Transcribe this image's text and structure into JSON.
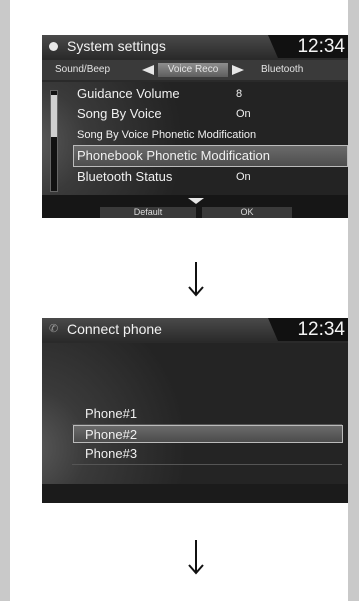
{
  "screen1": {
    "title": "System settings",
    "clock": "12:34",
    "tabs": {
      "left": "Sound/Beep",
      "active": "Voice Reco",
      "right": "Bluetooth"
    },
    "rows": [
      {
        "label": "Guidance Volume",
        "value": "8"
      },
      {
        "label": "Song By Voice",
        "value": "On"
      },
      {
        "label": "Song By Voice Phonetic Modification",
        "value": ""
      },
      {
        "label": "Phonebook Phonetic Modification",
        "value": ""
      },
      {
        "label": "Bluetooth Status",
        "value": "On"
      }
    ],
    "selected_row": "Phonebook Phonetic Modification",
    "softkeys": {
      "default": "Default",
      "ok": "OK"
    }
  },
  "screen2": {
    "title": "Connect phone",
    "clock": "12:34",
    "phones": [
      "Phone#1",
      "Phone#2",
      "Phone#3"
    ],
    "selected_phone": "Phone#2"
  },
  "icons": {
    "screen1_title": "gear-icon",
    "screen2_title": "phone-icon",
    "step_arrow": "arrow-down-icon"
  }
}
